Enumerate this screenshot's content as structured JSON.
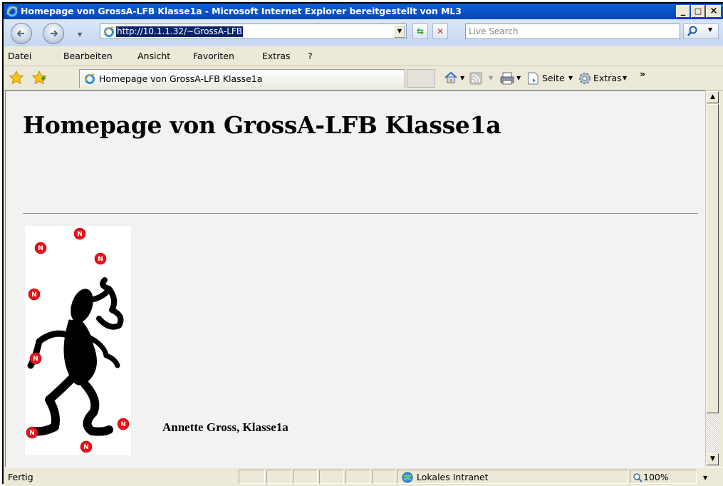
{
  "window": {
    "title": "Homepage von GrossA-LFB Klasse1a - Microsoft Internet Explorer bereitgestellt von ML3",
    "minimize": "_",
    "maximize": "□",
    "close": "×"
  },
  "address_bar": {
    "url": "http://10.1.1.32/~GrossA-LFB",
    "search_placeholder": "Live Search"
  },
  "menu": {
    "items": [
      "Datei",
      "Bearbeiten",
      "Ansicht",
      "Favoriten",
      "Extras",
      "?"
    ]
  },
  "tabbar": {
    "tab_label": "Homepage von GrossA-LFB Klasse1a",
    "seite_label": "Seite",
    "extras_label": "Extras",
    "overflow": "»"
  },
  "page": {
    "heading": "Homepage von GrossA-LFB Klasse1a",
    "signature": "Annette Gross, Klasse1a",
    "picture_icon": "juggler-clipart"
  },
  "status": {
    "text": "Fertig",
    "zone": "Lokales Intranet",
    "zoom": "100%"
  },
  "colors": {
    "titlebar": "#0846b5",
    "content_bg": "#f2f2f2",
    "url_highlight": "#0a246a",
    "juggling_ball": "#e8121b"
  }
}
